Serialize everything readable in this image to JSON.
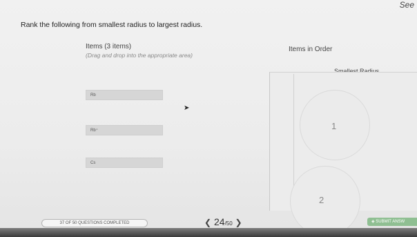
{
  "corner": {
    "text": "See"
  },
  "question": {
    "instruction": "Rank the following from smallest radius to largest radius."
  },
  "items_panel": {
    "title": "Items (3 items)",
    "hint": "(Drag and drop into the appropriate area)",
    "items": [
      {
        "label": "Rb"
      },
      {
        "label": "Rb⁺"
      },
      {
        "label": "Cs"
      }
    ]
  },
  "order_panel": {
    "title": "Items in Order",
    "top_label": "Smallest Radius",
    "slots": [
      "1",
      "2"
    ]
  },
  "footer": {
    "progress_text": "37 OF 50 QUESTIONS COMPLETED",
    "current": "24",
    "total": "/50",
    "prev_icon": "chevron-left",
    "next_icon": "chevron-right",
    "submit_label": "SUBMIT ANSW"
  }
}
